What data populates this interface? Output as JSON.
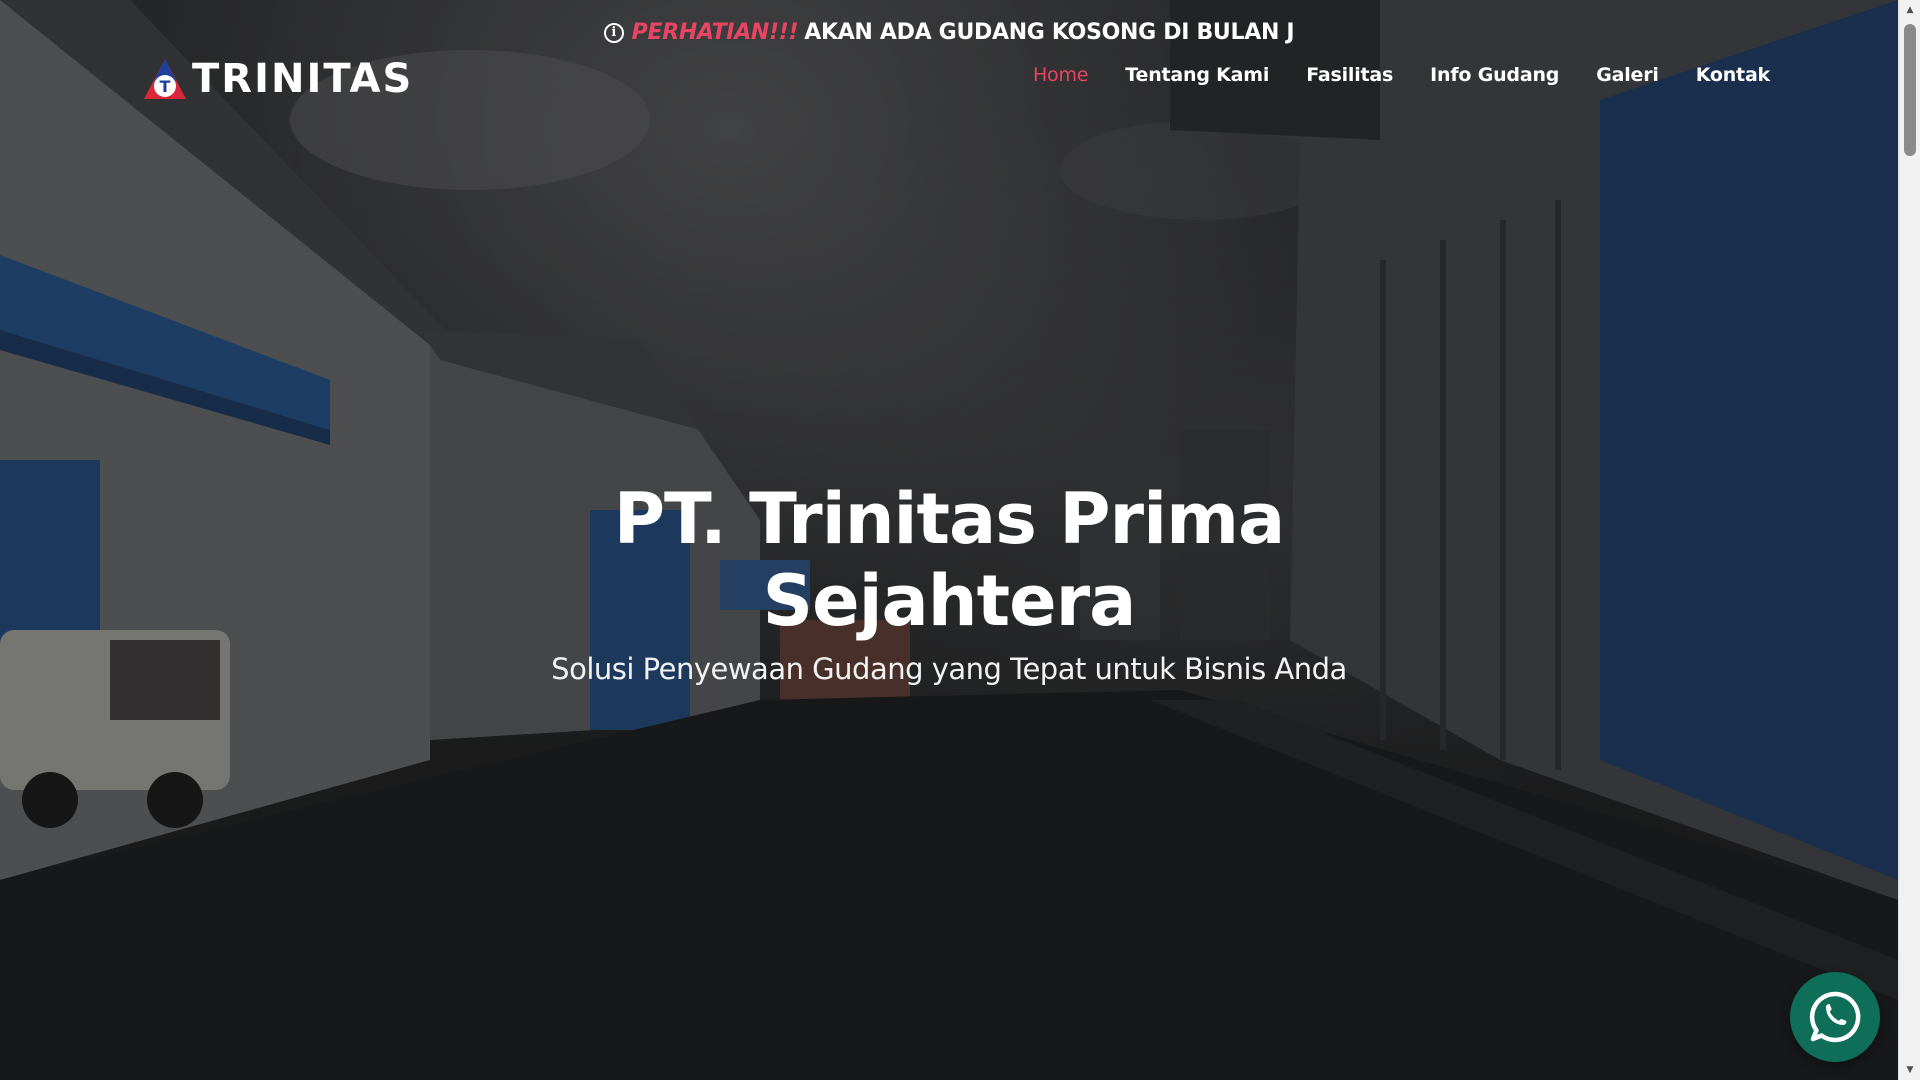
{
  "notice": {
    "icon": "info-circle-icon",
    "alert": "PERHATIAN!!!",
    "message": "AKAN ADA GUDANG KOSONG DI BULAN J"
  },
  "header": {
    "brand": "TRINITAS",
    "logo_icon": "triangle-t-logo-icon",
    "logo_letter": "T",
    "logo_colors": {
      "blue": "#1f3f9c",
      "red": "#d8283a",
      "white": "#ffffff"
    }
  },
  "nav": {
    "items": [
      {
        "label": "Home",
        "active": true
      },
      {
        "label": "Tentang Kami",
        "active": false
      },
      {
        "label": "Fasilitas",
        "active": false
      },
      {
        "label": "Info Gudang",
        "active": false
      },
      {
        "label": "Galeri",
        "active": false
      },
      {
        "label": "Kontak",
        "active": false
      }
    ]
  },
  "hero": {
    "title_line1": "PT. Trinitas Prima",
    "title_line2": "Sejahtera",
    "subtitle": "Solusi Penyewaan Gudang yang Tepat untuk Bisnis Anda"
  },
  "floating": {
    "whatsapp_icon": "whatsapp-icon",
    "color": "#0e6e57"
  },
  "colors": {
    "accent": "#e84563",
    "text": "#ffffff"
  }
}
